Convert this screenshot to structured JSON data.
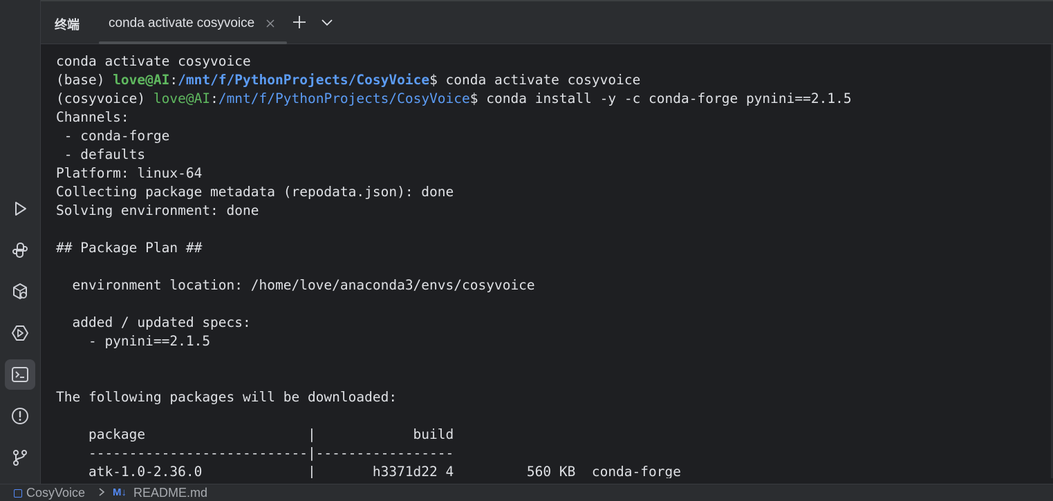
{
  "toolwindow": {
    "title": "终端",
    "tab_label": "conda activate cosyvoice"
  },
  "terminal": {
    "lines": [
      {
        "parts": [
          {
            "t": "conda activate cosyvoice",
            "c": "plain"
          }
        ]
      },
      {
        "parts": [
          {
            "t": "(base) ",
            "c": "plain"
          },
          {
            "t": "love@AI",
            "c": "user"
          },
          {
            "t": ":",
            "c": "plain"
          },
          {
            "t": "/mnt/f/PythonProjects/CosyVoice",
            "c": "path"
          },
          {
            "t": "$ conda activate cosyvoice",
            "c": "plain"
          }
        ]
      },
      {
        "parts": [
          {
            "t": "(cosyvoice) ",
            "c": "plain"
          },
          {
            "t": "love@AI",
            "c": "user-plain"
          },
          {
            "t": ":",
            "c": "plain"
          },
          {
            "t": "/mnt/f/PythonProjects/CosyVoice",
            "c": "path-plain"
          },
          {
            "t": "$ conda install -y -c conda-forge pynini==2.1.5",
            "c": "plain"
          }
        ]
      },
      {
        "parts": [
          {
            "t": "Channels:",
            "c": "plain"
          }
        ]
      },
      {
        "parts": [
          {
            "t": " - conda-forge",
            "c": "plain"
          }
        ]
      },
      {
        "parts": [
          {
            "t": " - defaults",
            "c": "plain"
          }
        ]
      },
      {
        "parts": [
          {
            "t": "Platform: linux-64",
            "c": "plain"
          }
        ]
      },
      {
        "parts": [
          {
            "t": "Collecting package metadata (repodata.json): done",
            "c": "plain"
          }
        ]
      },
      {
        "parts": [
          {
            "t": "Solving environment: done",
            "c": "plain"
          }
        ]
      },
      {
        "parts": [
          {
            "t": "",
            "c": "plain"
          }
        ]
      },
      {
        "parts": [
          {
            "t": "## Package Plan ##",
            "c": "plain"
          }
        ]
      },
      {
        "parts": [
          {
            "t": "",
            "c": "plain"
          }
        ]
      },
      {
        "parts": [
          {
            "t": "  environment location: /home/love/anaconda3/envs/cosyvoice",
            "c": "plain"
          }
        ]
      },
      {
        "parts": [
          {
            "t": "",
            "c": "plain"
          }
        ]
      },
      {
        "parts": [
          {
            "t": "  added / updated specs:",
            "c": "plain"
          }
        ]
      },
      {
        "parts": [
          {
            "t": "    - pynini==2.1.5",
            "c": "plain"
          }
        ]
      },
      {
        "parts": [
          {
            "t": "",
            "c": "plain"
          }
        ]
      },
      {
        "parts": [
          {
            "t": "",
            "c": "plain"
          }
        ]
      },
      {
        "parts": [
          {
            "t": "The following packages will be downloaded:",
            "c": "plain"
          }
        ]
      },
      {
        "parts": [
          {
            "t": "",
            "c": "plain"
          }
        ]
      },
      {
        "parts": [
          {
            "t": "    package                    |            build",
            "c": "plain"
          }
        ]
      },
      {
        "parts": [
          {
            "t": "    ---------------------------|-----------------",
            "c": "plain"
          }
        ]
      },
      {
        "parts": [
          {
            "t": "    atk-1.0-2.36.0             |       h3371d22_4         560 KB  conda-forge",
            "c": "plain"
          }
        ]
      }
    ]
  },
  "statusbar": {
    "project": "CosyVoice",
    "md_badge": "M↓",
    "file": "README.md"
  },
  "colors": {
    "user": "#5fb85f",
    "path": "#5c9cf5",
    "text": "#dfe1e5",
    "background": "#1e1f22"
  },
  "icons": {
    "left_strip": [
      "run-icon",
      "python-console-icon",
      "services-icon",
      "endpoints-icon",
      "terminal-icon",
      "problems-icon",
      "git-icon"
    ]
  }
}
